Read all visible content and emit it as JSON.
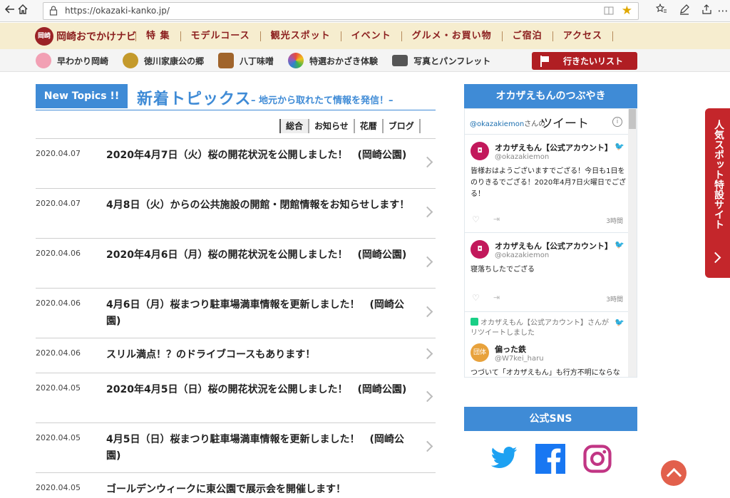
{
  "browser": {
    "url": "https://okazaki-kanko.jp/"
  },
  "site": {
    "logo_seal": "岡崎",
    "logo_text": "岡崎おでかけナビ",
    "nav_main": [
      "特 集",
      "モデルコース",
      "観光スポット",
      "イベント",
      "グルメ・お買い物",
      "ご宿泊",
      "アクセス"
    ],
    "nav_sub": [
      {
        "label": "早わかり岡崎",
        "icon": "sakura-icon",
        "color": "#f2a0b4"
      },
      {
        "label": "徳川家康公の郷",
        "icon": "crest-icon",
        "color": "#c49a2c"
      },
      {
        "label": "八丁味噌",
        "icon": "miso-barrel-icon",
        "color": "#a0642c"
      },
      {
        "label": "特選おかざき体験",
        "icon": "colorful-wheel-icon",
        "color": "#e8a23c"
      },
      {
        "label": "写真とパンフレット",
        "icon": "camera-icon",
        "color": "#555555"
      }
    ],
    "wishlist_label": "行きたいリスト"
  },
  "topics": {
    "badge": "New Topics !!",
    "title": "新着トピックス",
    "subtitle": "– 地元から取れたて情報を発信！–",
    "tabs": [
      "総合",
      "お知らせ",
      "花暦",
      "ブログ"
    ],
    "items": [
      {
        "date": "2020.04.07",
        "title": "2020年4月7日（火）桜の開花状況を公開しました！　(岡崎公園)"
      },
      {
        "date": "2020.04.07",
        "title": "4月8日（火）からの公共施設の開館・閉館情報をお知らせします！"
      },
      {
        "date": "2020.04.06",
        "title": "2020年4月6日（月）桜の開花状況を公開しました！　(岡崎公園)"
      },
      {
        "date": "2020.04.06",
        "title": "4月6日（月）桜まつり駐車場満車情報を更新しました！　(岡崎公園)"
      },
      {
        "date": "2020.04.06",
        "title": "スリル満点！？のドライブコースもあります！"
      },
      {
        "date": "2020.04.05",
        "title": "2020年4月5日（日）桜の開花状況を公開しました！　(岡崎公園)"
      },
      {
        "date": "2020.04.05",
        "title": "4月5日（日）桜まつり駐車場満車情報を更新しました！　(岡崎公園)"
      },
      {
        "date": "2020.04.05",
        "title": "ゴールデンウィークに東公園で展示会を開催します！"
      }
    ]
  },
  "twitter": {
    "header": "オカザえもんのつぶやき",
    "handle": "@okazakiemon",
    "handle_suffix": "さんの",
    "tweet_word": "ツイート",
    "tweets": [
      {
        "name": "オカザえもん【公式アカウント】",
        "user": "@okazakiemon",
        "text": "皆様おはようございますでござる！今日も1日をのりきるでござる！2020年4月7日火曜日でござる！",
        "time": "3時間"
      },
      {
        "name": "オカザえもん【公式アカウント】",
        "user": "@okazakiemon",
        "text": "寝落ちしたでござる",
        "time": "3時間"
      }
    ],
    "retweet": {
      "rt_text": "オカザえもん【公式アカウント】さんがリツイートしました",
      "name": "偏った鉄",
      "user": "@W7kei_haru",
      "avatar_text": "団体",
      "text": "つづいて「オカザえもん」も行方不明にならな"
    }
  },
  "sns": {
    "header": "公式SNS",
    "icons": [
      "twitter-icon",
      "facebook-icon",
      "instagram-icon"
    ],
    "colors": {
      "twitter": "#1da1f2",
      "facebook": "#1877f2",
      "instagram": "#c13584"
    }
  },
  "side_tab": {
    "label": "人気スポット特設サイト"
  }
}
